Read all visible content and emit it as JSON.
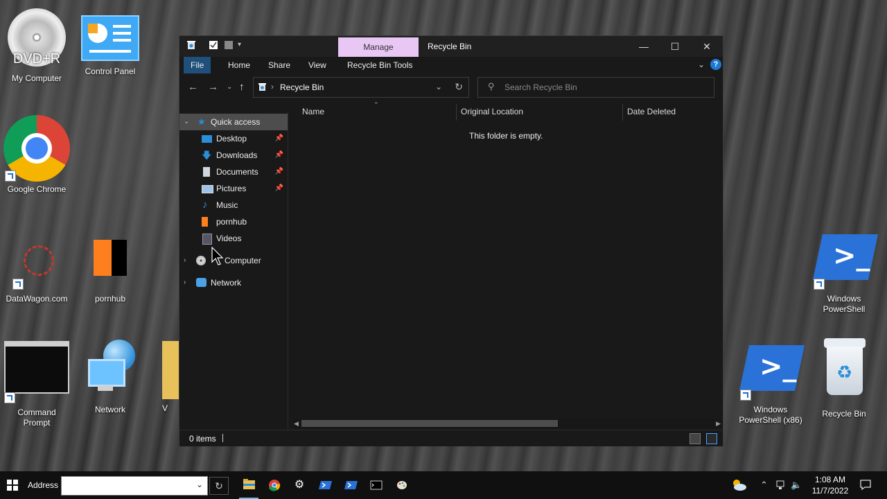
{
  "desktop": {
    "icons": [
      {
        "label": "My Computer",
        "badge": "DVD+R"
      },
      {
        "label": "Control Panel"
      },
      {
        "label": "Google Chrome"
      },
      {
        "label": "DataWagon.com"
      },
      {
        "label": "pornhub"
      },
      {
        "label": "Command Prompt"
      },
      {
        "label": "Network"
      },
      {
        "label": "Windows PowerShell"
      },
      {
        "label": "Windows PowerShell (x86)"
      },
      {
        "label": "Recycle Bin"
      }
    ],
    "partial_folder_label": "V"
  },
  "window": {
    "title": "Recycle Bin",
    "context_tab": "Manage",
    "ribbon_tabs": [
      "File",
      "Home",
      "Share",
      "View",
      "Recycle Bin Tools"
    ],
    "help_label": "?",
    "address": {
      "crumb": "Recycle Bin"
    },
    "search": {
      "placeholder": "Search Recycle Bin"
    },
    "nav": {
      "quick_access": "Quick access",
      "items": [
        {
          "label": "Desktop",
          "pinned": true
        },
        {
          "label": "Downloads",
          "pinned": true
        },
        {
          "label": "Documents",
          "pinned": true
        },
        {
          "label": "Pictures",
          "pinned": true
        },
        {
          "label": "Music",
          "pinned": false
        },
        {
          "label": "pornhub",
          "pinned": false
        },
        {
          "label": "Videos",
          "pinned": false
        }
      ],
      "computer": "Computer",
      "network": "Network"
    },
    "columns": [
      "Name",
      "Original Location",
      "Date Deleted"
    ],
    "empty_message": "This folder is empty.",
    "status": {
      "count": "0 items"
    }
  },
  "taskbar": {
    "address_label": "Address",
    "address_value": "",
    "time": "1:08 AM",
    "date": "11/7/2022"
  },
  "colors": {
    "accent": "#1f79d1",
    "manage_tab": "#e8c7f5",
    "window_bg": "#191919"
  }
}
